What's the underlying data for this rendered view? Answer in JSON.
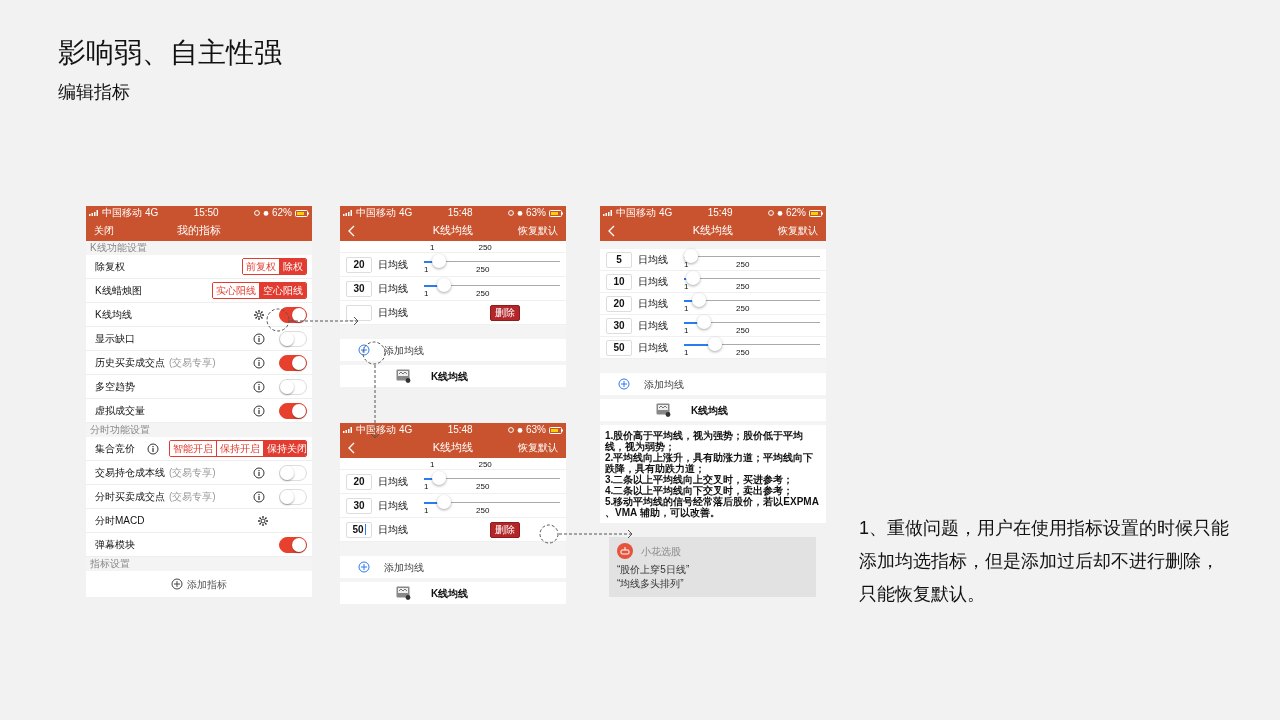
{
  "title": "影响弱、自主性强",
  "subtitle": "编辑指标",
  "screens": [
    {
      "kind": "settings",
      "status": {
        "carrier": "中国移动",
        "network": "4G",
        "time": "15:50",
        "battery": "62%"
      },
      "nav": {
        "left": "关闭",
        "title": "我的指标"
      },
      "sections": [
        {
          "header": "K线功能设置",
          "rows": [
            {
              "label": "除复权",
              "kind": "segmented",
              "options": [
                {
                  "label": "前复权",
                  "selected": false
                },
                {
                  "label": "除权",
                  "selected": true
                }
              ]
            },
            {
              "label": "K线蜡烛图",
              "kind": "segmented",
              "options": [
                {
                  "label": "实心阳线",
                  "selected": false
                },
                {
                  "label": "空心阳线",
                  "selected": true
                }
              ]
            },
            {
              "label": "K线均线",
              "kind": "switch",
              "button": {
                "kind": "gear"
              },
              "on": true
            },
            {
              "label": "显示缺口",
              "kind": "switch",
              "button": {
                "kind": "info"
              },
              "on": false
            },
            {
              "label": "历史买卖成交点",
              "note": "(交易专享)",
              "kind": "switch",
              "button": {
                "kind": "info"
              },
              "on": true
            },
            {
              "label": "多空趋势",
              "kind": "switch",
              "button": {
                "kind": "info"
              },
              "on": false
            },
            {
              "label": "虚拟成交量",
              "kind": "switch",
              "button": {
                "kind": "info"
              },
              "on": true
            }
          ]
        },
        {
          "header": "分时功能设置",
          "rows": [
            {
              "label": "集合竞价",
              "kind": "segmented",
              "button": {
                "kind": "info"
              },
              "options": [
                {
                  "label": "智能开启",
                  "selected": false
                },
                {
                  "label": "保持开启",
                  "selected": false
                },
                {
                  "label": "保持关闭",
                  "selected": true
                }
              ]
            },
            {
              "label": "交易持仓成本线",
              "note": "(交易专享)",
              "kind": "switch",
              "button": {
                "kind": "info"
              },
              "on": false
            },
            {
              "label": "分时买卖成交点",
              "note": "(交易专享)",
              "kind": "switch",
              "button": {
                "kind": "info"
              },
              "on": false
            },
            {
              "label": "分时MACD",
              "kind": "plain",
              "button": {
                "kind": "gear"
              }
            },
            {
              "label": "弹幕模块",
              "kind": "switch",
              "on": true
            }
          ]
        },
        {
          "header": "指标设置",
          "rows": [
            {
              "label": "添加指标",
              "kind": "add"
            }
          ]
        }
      ]
    },
    {
      "kind": "ma",
      "status": {
        "carrier": "中国移动",
        "network": "4G",
        "time": "15:48",
        "battery": "63%"
      },
      "nav": {
        "title": "K线均线",
        "right": "恢复默认"
      },
      "lines": [
        {
          "kind": "clipped",
          "min": "1",
          "max": "250"
        },
        {
          "kind": "slider",
          "period": "20",
          "label": "日均线",
          "level": 0.08,
          "min": "1",
          "max": "250"
        },
        {
          "kind": "slider",
          "period": "30",
          "label": "日均线",
          "level": 0.12,
          "min": "1",
          "max": "250"
        },
        {
          "kind": "new",
          "label": "日均线",
          "action": "删除"
        }
      ],
      "add": "添加均线",
      "footer": "K线均线"
    },
    {
      "kind": "ma",
      "status": {
        "carrier": "中国移动",
        "network": "4G",
        "time": "15:48",
        "battery": "63%"
      },
      "nav": {
        "title": "K线均线",
        "right": "恢复默认"
      },
      "lines": [
        {
          "kind": "clipped",
          "min": "1",
          "max": "250"
        },
        {
          "kind": "slider",
          "period": "20",
          "label": "日均线",
          "level": 0.08,
          "min": "1",
          "max": "250"
        },
        {
          "kind": "slider",
          "period": "30",
          "label": "日均线",
          "level": 0.12,
          "min": "1",
          "max": "250"
        },
        {
          "kind": "new",
          "period": "50",
          "editing": true,
          "label": "日均线",
          "action": "删除"
        }
      ],
      "add": "添加均线",
      "footer": "K线均线"
    },
    {
      "kind": "ma",
      "status": {
        "carrier": "中国移动",
        "network": "4G",
        "time": "15:49",
        "battery": "62%"
      },
      "nav": {
        "title": "K线均线",
        "right": "恢复默认"
      },
      "lines": [
        {
          "kind": "slider",
          "period": "5",
          "label": "日均线",
          "level": 0.02,
          "min": "1",
          "max": "250"
        },
        {
          "kind": "slider",
          "period": "10",
          "label": "日均线",
          "level": 0.04,
          "min": "1",
          "max": "250"
        },
        {
          "kind": "slider",
          "period": "20",
          "label": "日均线",
          "level": 0.08,
          "min": "1",
          "max": "250"
        },
        {
          "kind": "slider",
          "period": "30",
          "label": "日均线",
          "level": 0.12,
          "min": "1",
          "max": "250"
        },
        {
          "kind": "slider",
          "period": "50",
          "label": "日均线",
          "level": 0.2,
          "min": "1",
          "max": "250"
        }
      ],
      "add": "添加均线",
      "footer": "K线均线",
      "description": [
        "1.股价高于平均线，视为强势；股价低于平均线，视为弱势；",
        "2.平均线向上涨升，具有助涨力道；平均线向下跌降，具有助跌力道；",
        "3.二条以上平均线向上交叉时，买进参考；",
        "4.二条以上平均线向下交叉时，卖出参考；",
        "5.移动平均线的信号经常落后股价，若以EXPMA 、VMA 辅助，可以改善。"
      ]
    }
  ],
  "popup": {
    "app": "小花选股",
    "lines": [
      "“股价上穿5日线”",
      "“均线多头排列”"
    ]
  },
  "note": "1、重做问题，用户在使用指标设置的时候只能添加均选指标，但是添加过后却不进行删除，只能恢复默认。"
}
